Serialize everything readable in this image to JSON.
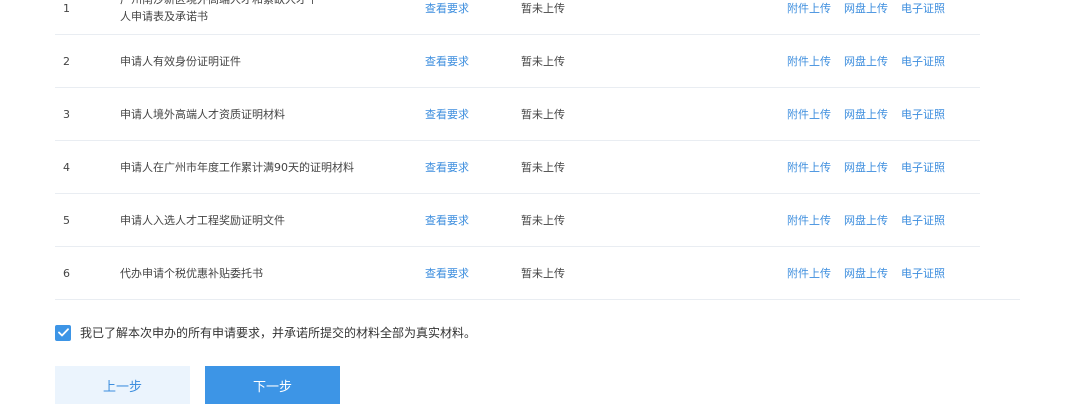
{
  "materials": {
    "view_label": "查看要求",
    "rows": [
      {
        "index": "1",
        "name_line1": "广州南沙新区境外高端人才和紧缺人才个",
        "name_line2": "人申请表及承诺书",
        "status": "暂未上传"
      },
      {
        "index": "2",
        "name": "申请人有效身份证明证件",
        "status": "暂未上传"
      },
      {
        "index": "3",
        "name": "申请人境外高端人才资质证明材料",
        "status": "暂未上传"
      },
      {
        "index": "4",
        "name": "申请人在广州市年度工作累计满90天的证明材料",
        "status": "暂未上传"
      },
      {
        "index": "5",
        "name": "申请人入选人才工程奖励证明文件",
        "status": "暂未上传"
      },
      {
        "index": "6",
        "name": "代办申请个税优惠补贴委托书",
        "status": "暂未上传"
      }
    ],
    "actions": {
      "attach_upload": "附件上传",
      "cloud_upload": "网盘上传",
      "e_license": "电子证照"
    }
  },
  "agreement": {
    "checked": true,
    "text": "我已了解本次申办的所有申请要求，并承诺所提交的材料全部为真实材料。"
  },
  "buttons": {
    "prev": "上一步",
    "next": "下一步"
  },
  "colors": {
    "link": "#3d8ede",
    "primary": "#3d95e6",
    "secondary_bg": "#ebf4fd",
    "divider": "#e9edf2"
  }
}
